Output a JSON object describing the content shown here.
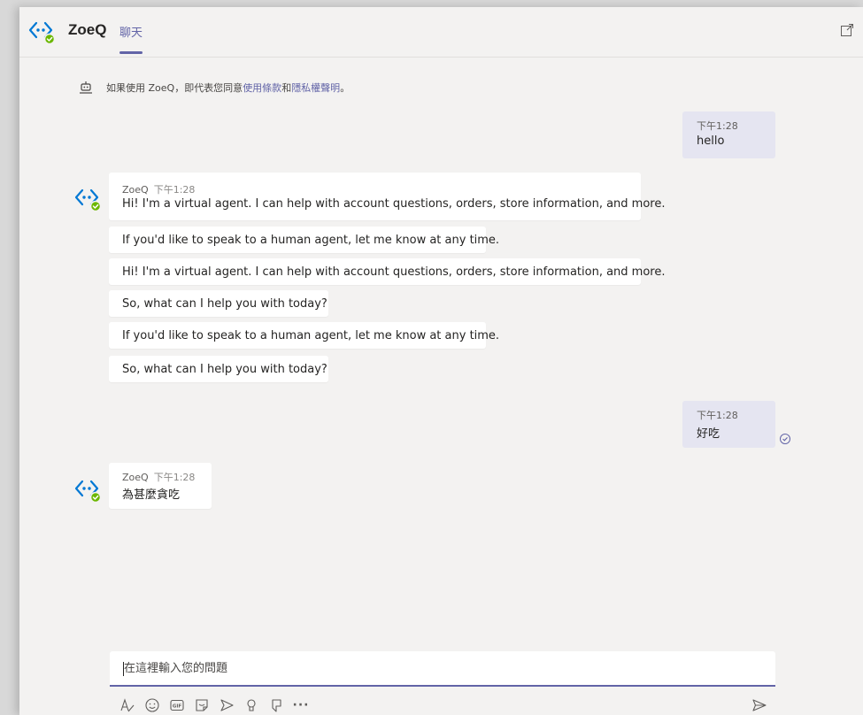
{
  "header": {
    "app_name": "ZoeQ",
    "tab_label": "聊天",
    "logo_icon": "bot-code-icon",
    "popout_icon": "popout-icon"
  },
  "consent": {
    "icon": "bot-icon",
    "prefix": "如果使用 ZoeQ，即代表您同意",
    "terms_link": "使用條款",
    "conjunction": "和",
    "privacy_link": "隱私權聲明",
    "suffix": "。"
  },
  "messages": [
    {
      "from": "user",
      "time": "下午1:28",
      "text": "hello"
    },
    {
      "from": "bot",
      "sender": "ZoeQ",
      "time": "下午1:28",
      "texts": [
        "Hi! I'm a virtual agent. I can help with account questions, orders, store information, and more.",
        "If you'd like to speak to a human agent, let me know at any time.",
        "Hi! I'm a virtual agent. I can help with account questions, orders, store information, and more.",
        "So, what can I help you with today?",
        "If you'd like to speak to a human agent, let me know at any time.",
        "So, what can I help you with today?"
      ]
    },
    {
      "from": "user",
      "time": "下午1:28",
      "text": "好吃"
    },
    {
      "from": "bot",
      "sender": "ZoeQ",
      "time": "下午1:28",
      "texts": [
        "為甚麼貪吃"
      ]
    }
  ],
  "composer": {
    "placeholder": "在這裡輸入您的問題",
    "tools": [
      "format-icon",
      "emoji-icon",
      "gif-icon",
      "sticker-icon",
      "meet-icon",
      "praise-icon",
      "more-apps-icon",
      "more-options-icon"
    ],
    "more_label": "···",
    "send_icon": "send-icon"
  },
  "colors": {
    "accent": "#6264a7",
    "user_bubble": "#e5e5f1",
    "bot_bubble": "#ffffff",
    "background": "#f3f2f1",
    "online_badge": "#6bb700"
  }
}
